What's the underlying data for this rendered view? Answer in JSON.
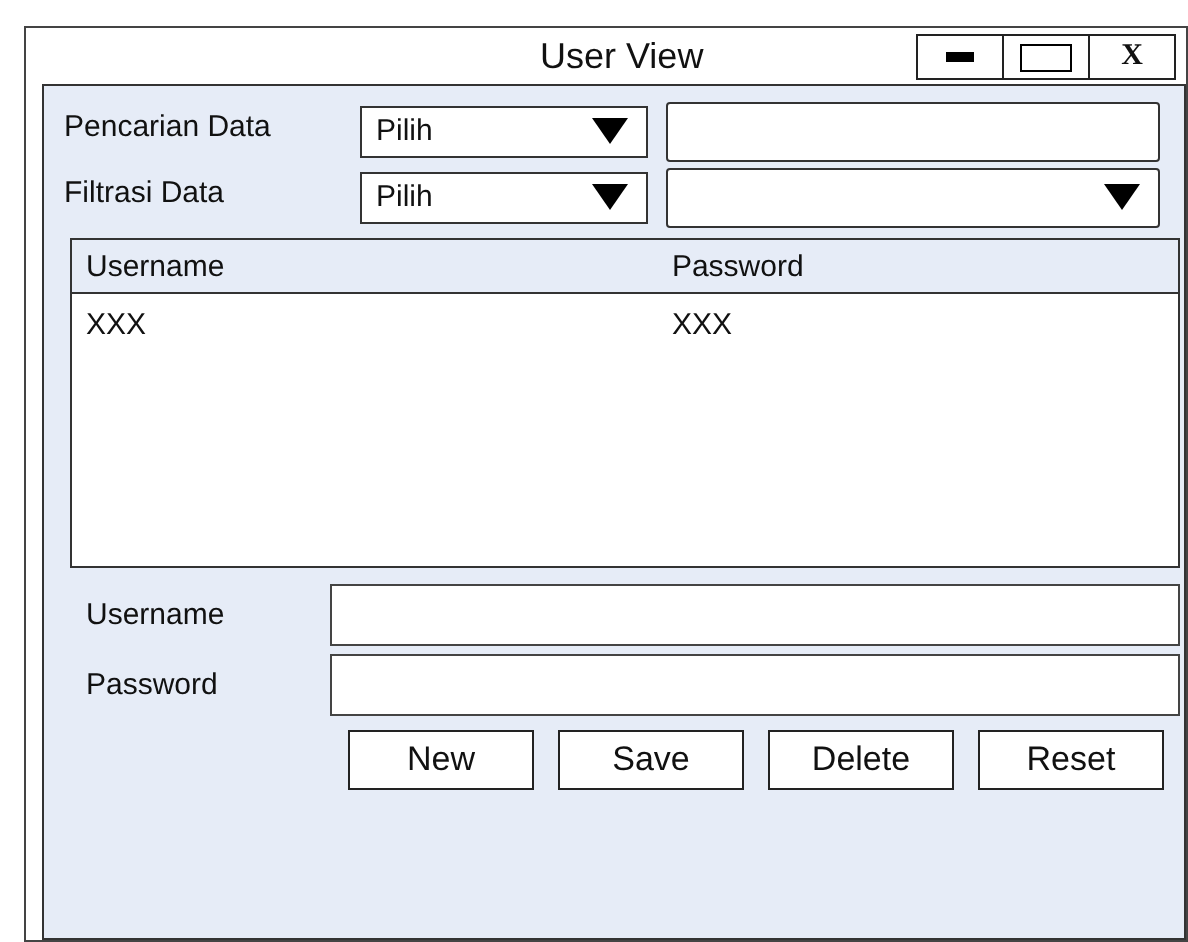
{
  "window": {
    "title": "User View",
    "controls": [
      {
        "kind": "minimize"
      },
      {
        "kind": "maximize"
      },
      {
        "kind": "close",
        "label": "X"
      }
    ]
  },
  "filters": [
    {
      "label": "Pencarian Data",
      "select": "Pilih",
      "field": {
        "kind": "text"
      }
    },
    {
      "label": "Filtrasi Data",
      "select": "Pilih",
      "field": {
        "kind": "dropdown"
      }
    }
  ],
  "table": {
    "columns": [
      "Username",
      "Password"
    ],
    "rows": [
      [
        "XXX",
        "XXX"
      ]
    ]
  },
  "form": [
    {
      "label": "Username"
    },
    {
      "label": "Password"
    }
  ],
  "buttons": [
    "New",
    "Save",
    "Delete",
    "Reset"
  ]
}
